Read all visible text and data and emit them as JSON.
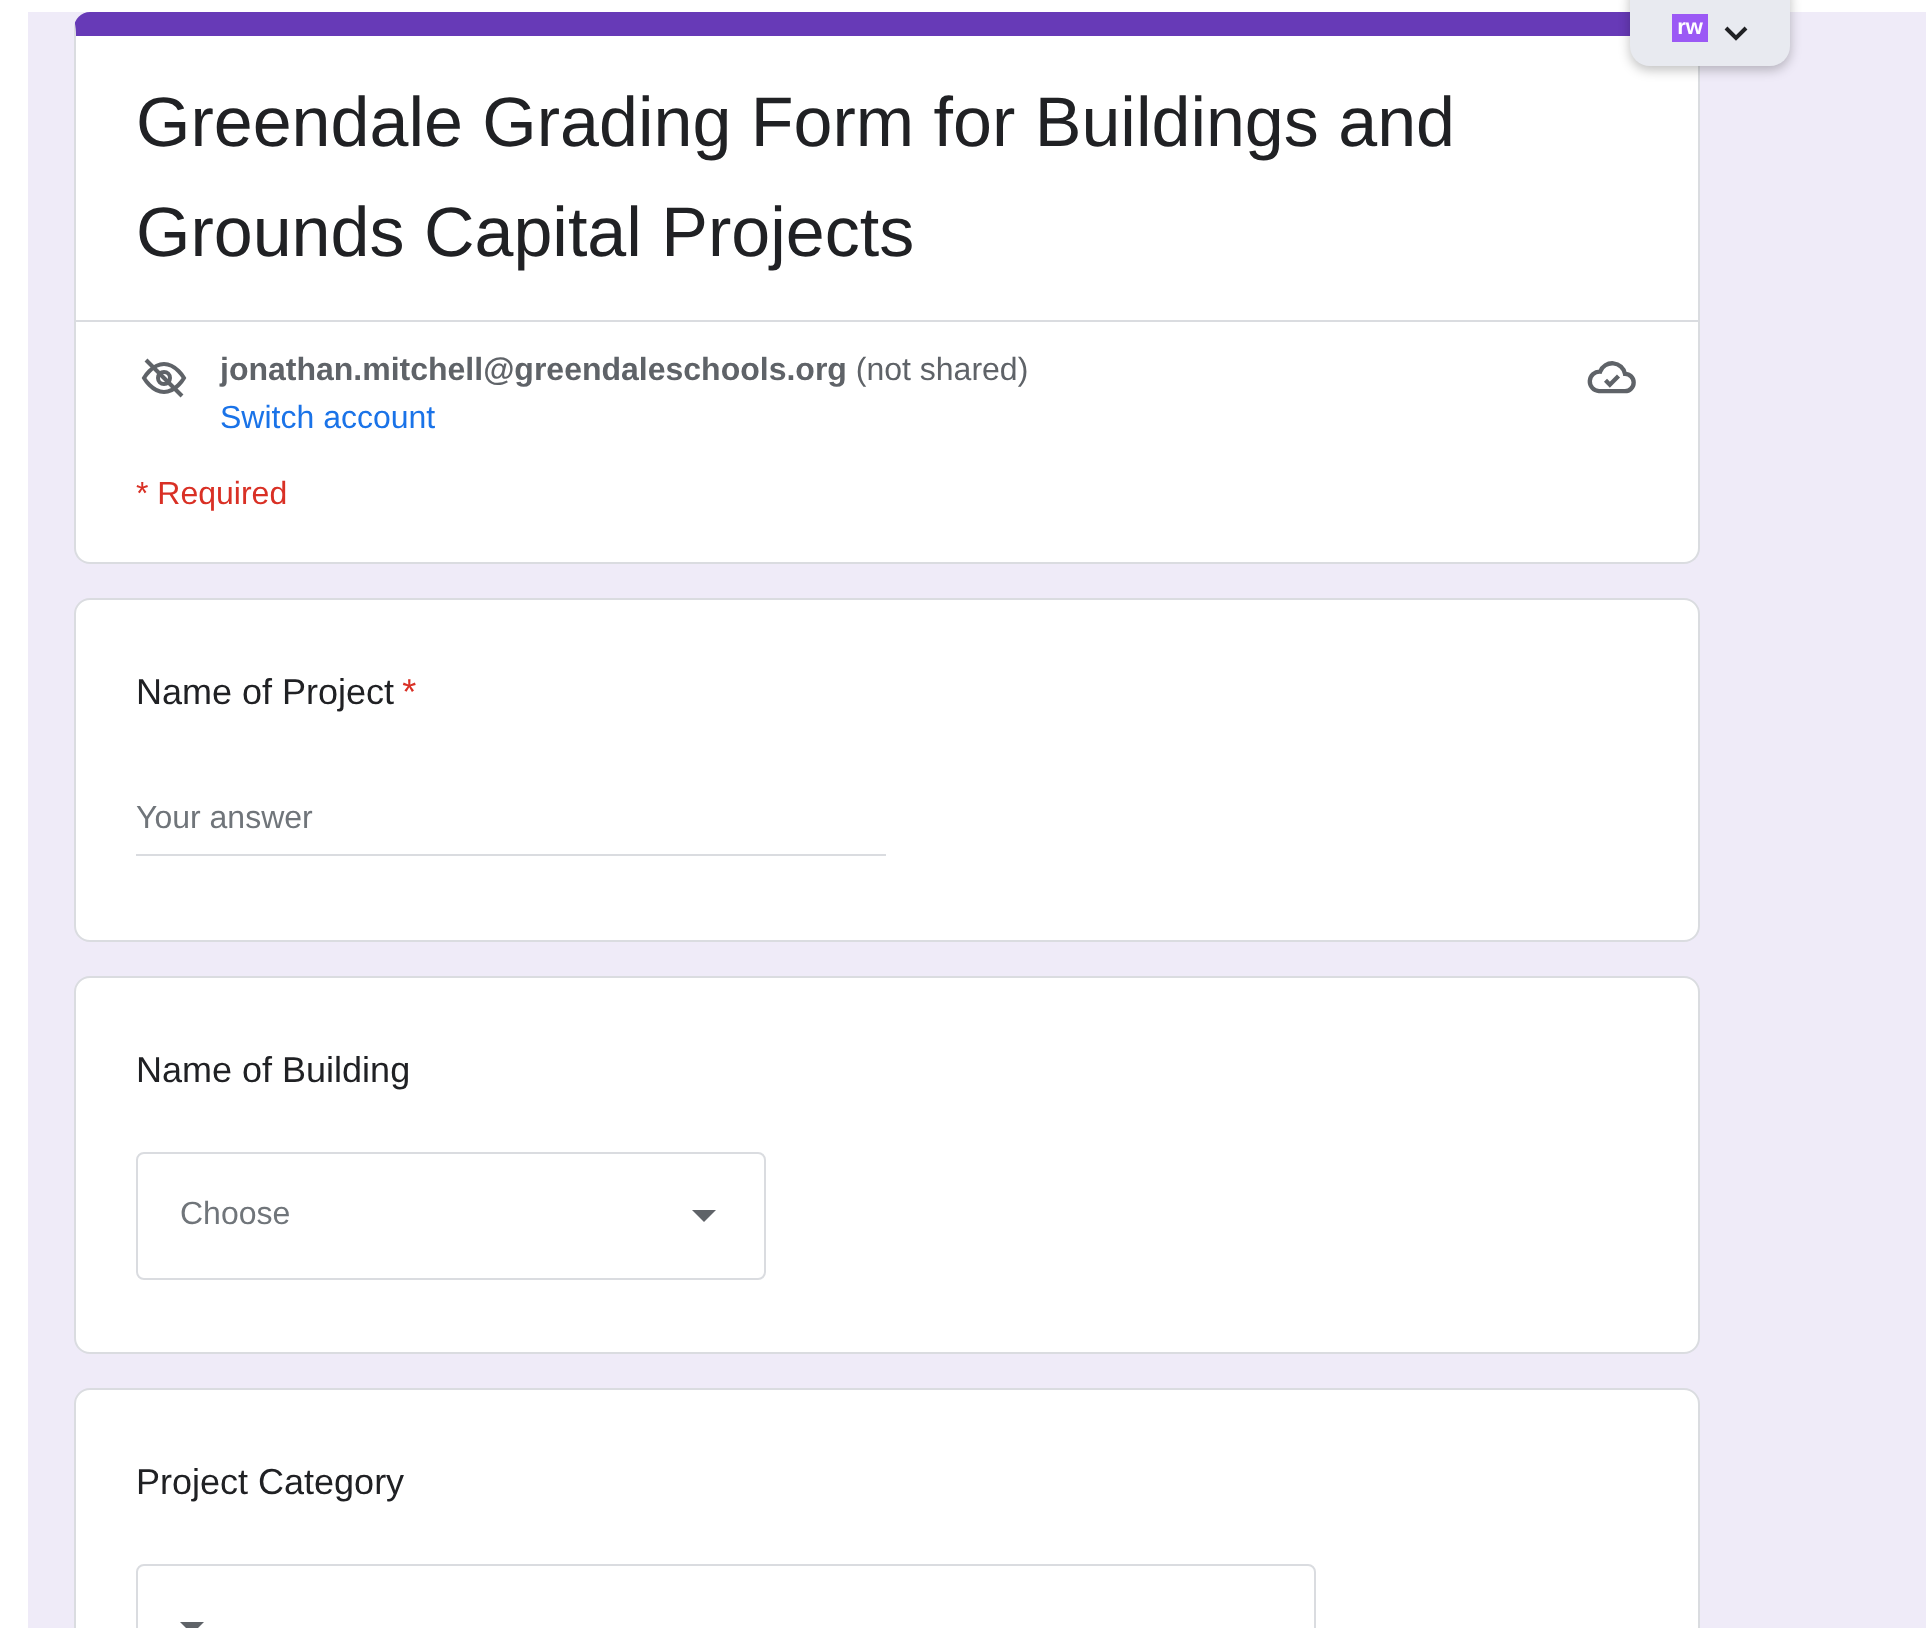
{
  "extension": {
    "badge": "rw",
    "expanded": false
  },
  "form": {
    "title": "Greendale Grading Form for Buildings and Grounds Capital Projects",
    "account": {
      "email": "jonathan.mitchell@greendaleschools.org",
      "sharing": "(not shared)",
      "switch_link": "Switch account"
    },
    "required_note": "* Required"
  },
  "questions": [
    {
      "kind": "text",
      "label": "Name of Project",
      "required": true,
      "required_mark": "*",
      "placeholder": "Your answer"
    },
    {
      "kind": "dropdown",
      "label": "Name of Building",
      "required": false,
      "placeholder": "Choose"
    },
    {
      "kind": "dropdown",
      "label": "Project Category",
      "required": false
    }
  ]
}
